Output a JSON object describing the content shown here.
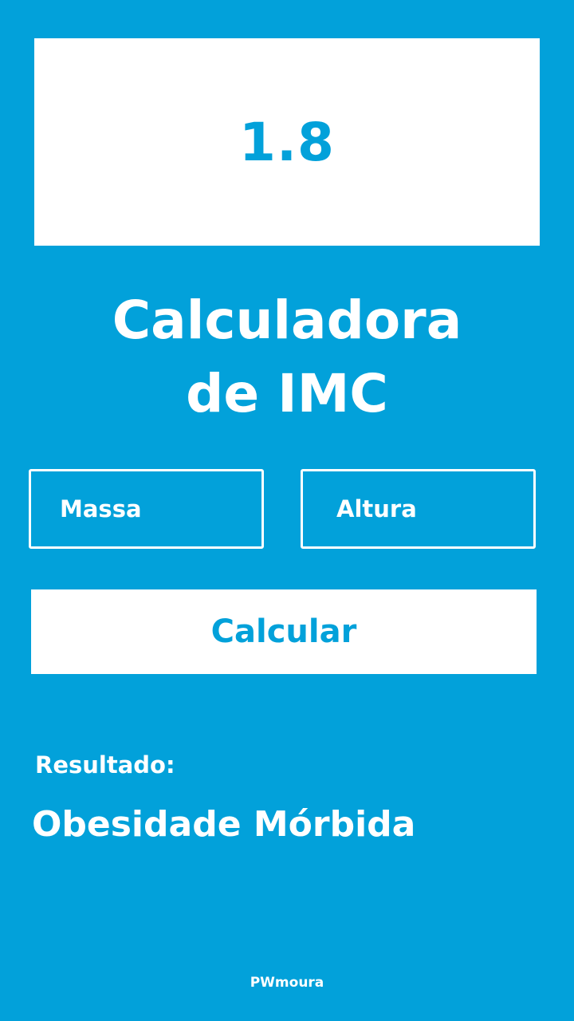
{
  "display": {
    "value": "1.8"
  },
  "title": {
    "line1": "Calculadora",
    "line2": "de IMC"
  },
  "inputs": {
    "massa": {
      "placeholder": "Massa",
      "value": ""
    },
    "altura": {
      "placeholder": "Altura",
      "value": ""
    }
  },
  "button": {
    "label": "Calcular"
  },
  "result": {
    "label": "Resultado:",
    "value": "Obesidade Mórbida"
  },
  "footer": {
    "credit": "PWmoura"
  },
  "colors": {
    "background": "#02a1da",
    "surface": "#ffffff",
    "text_on_background": "#ffffff",
    "text_on_surface": "#02a1da"
  }
}
